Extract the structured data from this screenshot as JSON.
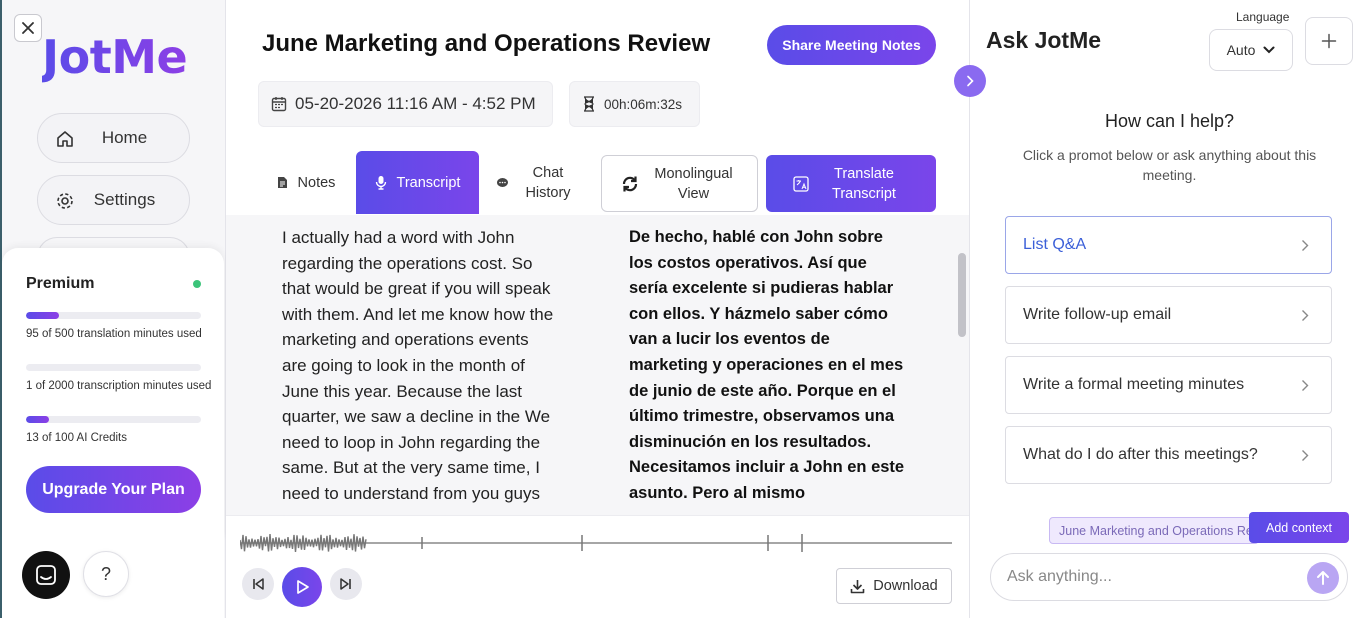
{
  "sidebar": {
    "logo": "JotMe",
    "nav": [
      {
        "label": "Home",
        "icon": "home-icon"
      },
      {
        "label": "Settings",
        "icon": "gear-icon"
      }
    ],
    "plan": {
      "title": "Premium",
      "usage": [
        {
          "text": "95 of 500 translation minutes used",
          "used": 95,
          "total": 500
        },
        {
          "text": "1 of 2000 transcription minutes used",
          "used": 1,
          "total": 2000
        },
        {
          "text": "13 of 100 AI Credits",
          "used": 13,
          "total": 100
        }
      ],
      "upgrade_label": "Upgrade Your Plan"
    },
    "help_label": "?"
  },
  "meeting": {
    "title": "June Marketing and Operations Review",
    "share_label": "Share Meeting Notes",
    "datetime": "05-20-2026 11:16 AM - 4:52 PM",
    "duration": "00h:06m:32s"
  },
  "tabs": {
    "notes": "Notes",
    "transcript": "Transcript",
    "chat_history": "Chat History",
    "monolingual": "Monolingual View",
    "translate": "Translate Transcript"
  },
  "transcript": {
    "original": "I actually had a word with John regarding the operations cost. So that would be great if you will speak with them. And let me know how the marketing and operations events are going to look in the month of June this year. Because the last quarter, we saw a decline in the We need to loop in John regarding the same. But at the very same time, I need to understand from you guys",
    "translated": "De hecho, hablé con John sobre los costos operativos. Así que sería excelente si pudieras hablar con ellos. Y házmelo saber cómo van a lucir los eventos de marketing y operaciones en el mes de junio de este año. Porque en el último trimestre, observamos una disminución en los resultados. Necesitamos incluir a John en este asunto. Pero al mismo"
  },
  "player": {
    "download_label": "Download"
  },
  "ask": {
    "title": "Ask JotMe",
    "language_label": "Language",
    "language_value": "Auto",
    "help_title": "How can I help?",
    "help_subtitle": "Click a promot below or ask anything about this meeting.",
    "prompts": [
      "List Q&A",
      "Write follow-up email",
      "Write a formal meeting minutes",
      "What do I do after this meetings?"
    ],
    "context_chip": "June Marketing and Operations Review",
    "add_context_label": "Add context",
    "input_placeholder": "Ask anything..."
  },
  "colors": {
    "accent": "#5a4ce8",
    "accent_end": "#8c3fe6",
    "status_dot": "#3cc47a"
  }
}
